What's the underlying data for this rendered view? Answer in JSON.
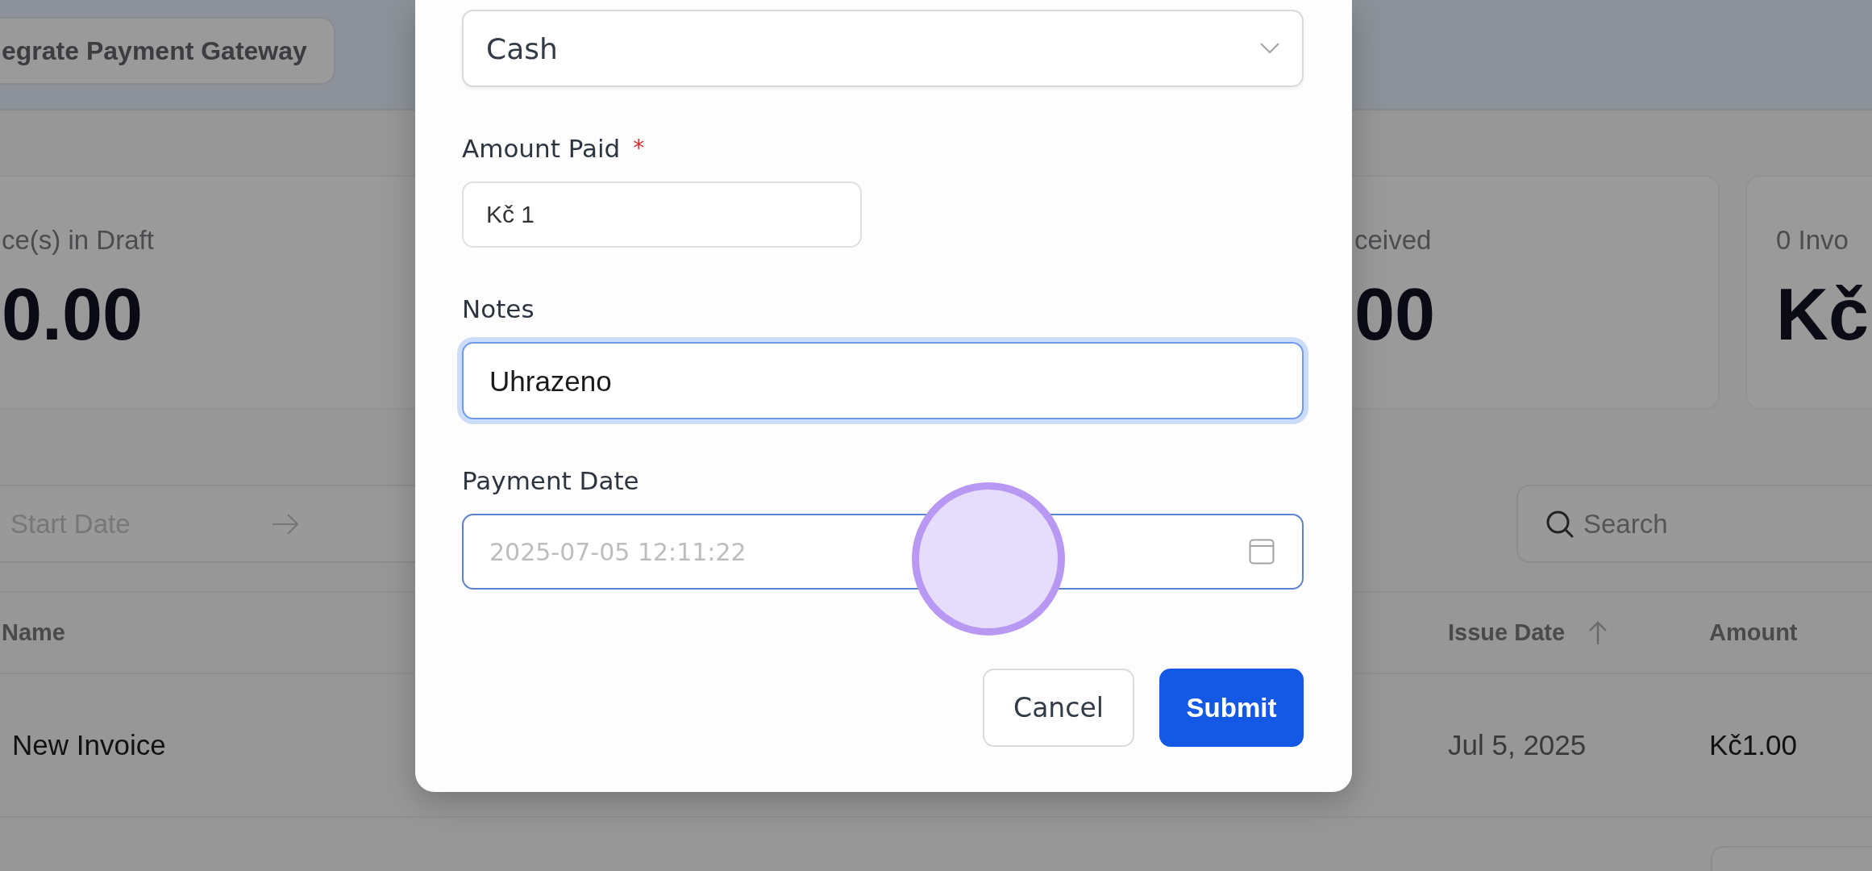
{
  "header": {
    "actions": [
      {
        "label": "egrate Payment Gateway"
      }
    ]
  },
  "stats": [
    {
      "label": "ce(s) in Draft",
      "value": "0.00"
    },
    {
      "label": "ceived",
      "value": "00"
    },
    {
      "label": "0 Invo",
      "value": "Kč"
    }
  ],
  "filters": {
    "date_range": {
      "placeholder": "Start Date"
    },
    "search": {
      "placeholder": "Search"
    }
  },
  "table": {
    "columns": [
      {
        "label": "Name",
        "sorted_ascending": false
      },
      {
        "label": "Issue Date",
        "sorted_ascending": true
      },
      {
        "label": "Amount",
        "sorted_ascending": false
      }
    ],
    "rows": [
      {
        "cells": [
          "New Invoice",
          "Jul 5, 2025",
          "Kč1.00"
        ]
      }
    ]
  },
  "dialog": {
    "fields": [
      {
        "kind": "select",
        "value": "Cash",
        "focused": false,
        "hovered": false
      },
      {
        "kind": "text",
        "label": "Amount Paid",
        "required_mark": "*",
        "value": "Kč 1",
        "focused": false,
        "hovered": false
      },
      {
        "kind": "textarea",
        "label": "Notes",
        "value": "Uhrazeno",
        "focused": true,
        "hovered": false
      },
      {
        "kind": "datetime",
        "label": "Payment Date",
        "placeholder": "2025-07-05 12:11:22",
        "focused": false,
        "hovered": true
      }
    ],
    "buttons": [
      {
        "label": "Cancel",
        "kind": "secondary"
      },
      {
        "label": "Submit",
        "kind": "primary"
      }
    ]
  }
}
